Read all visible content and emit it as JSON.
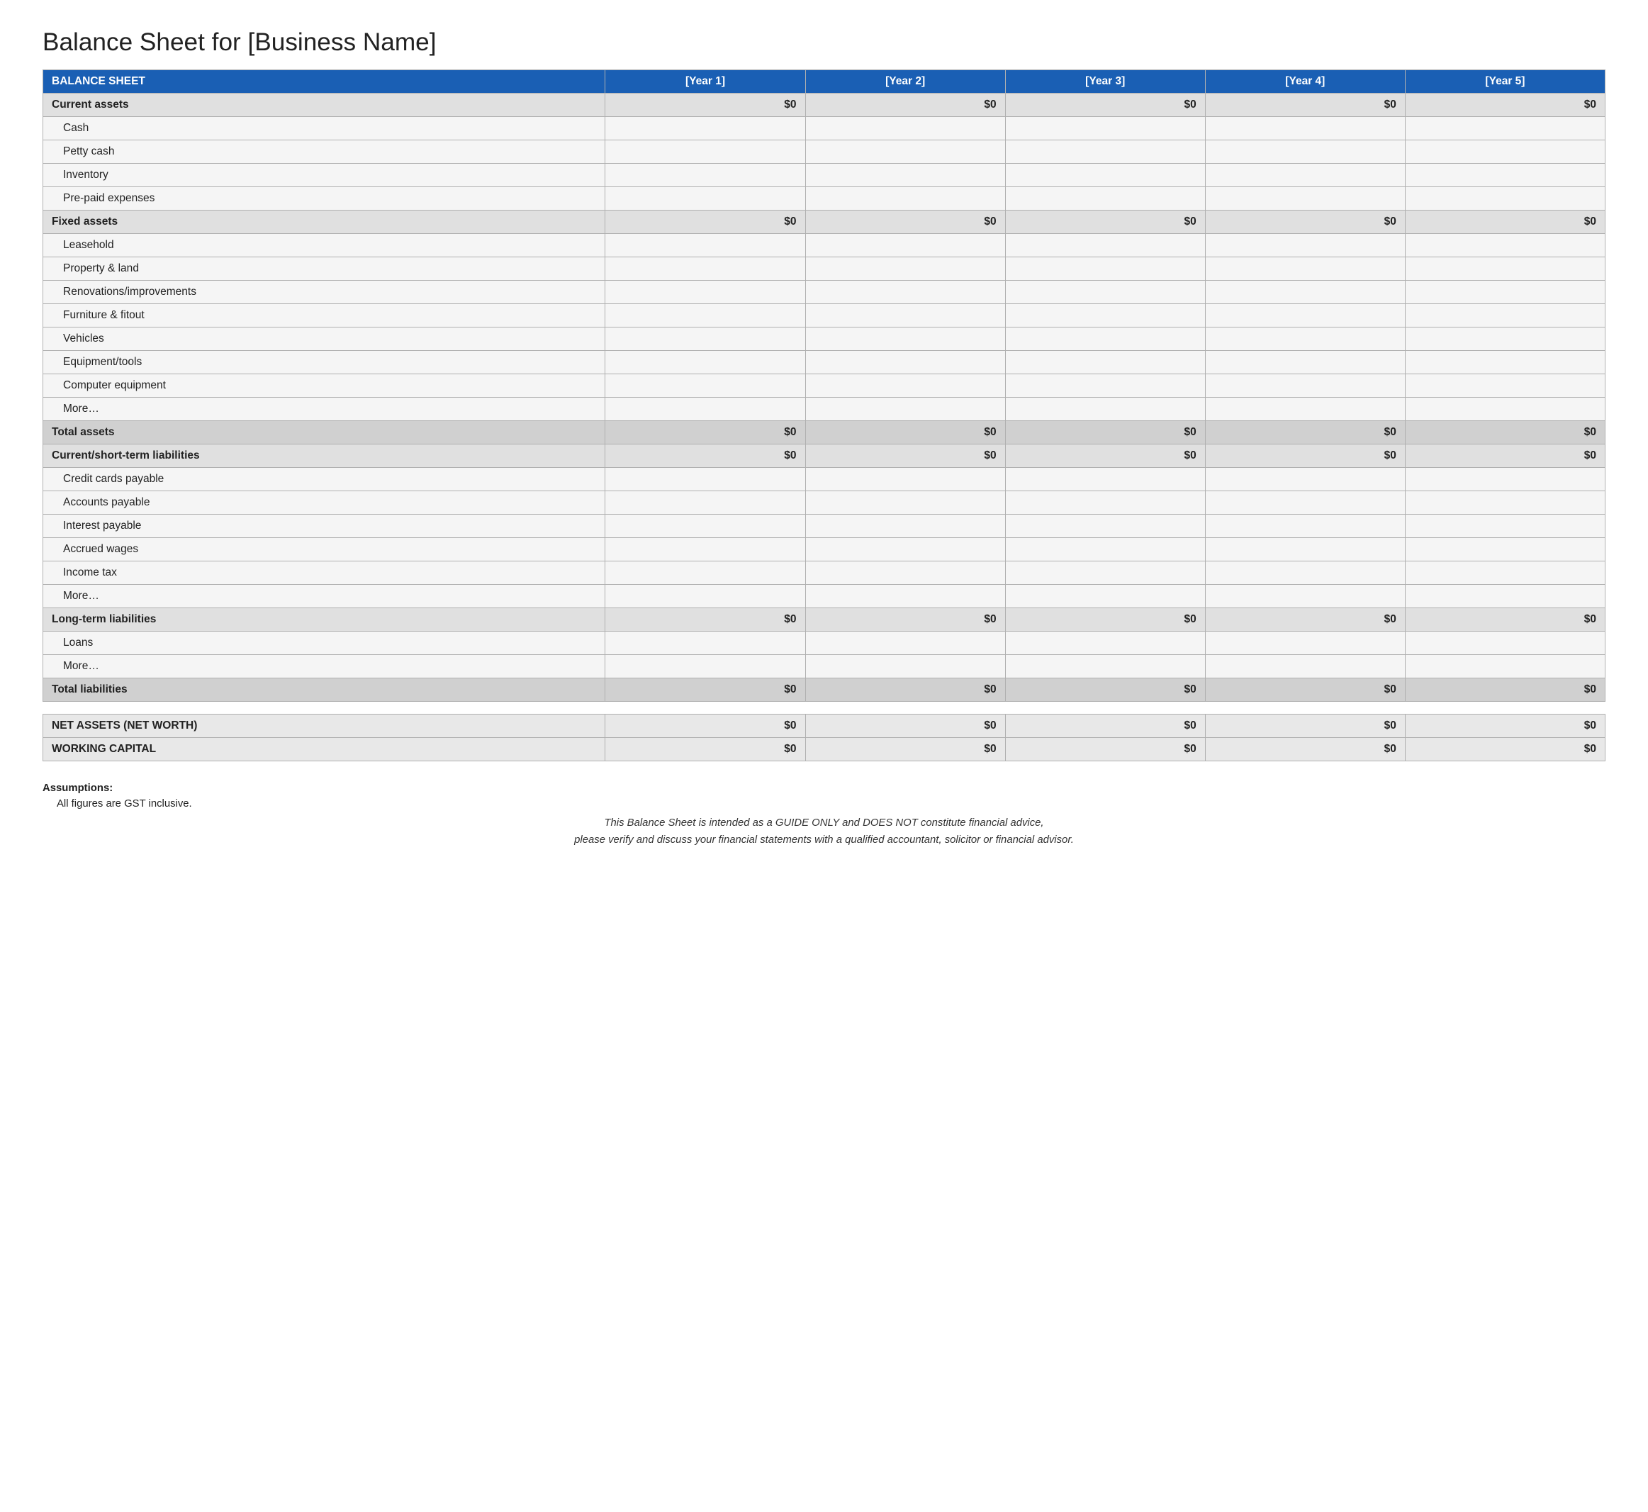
{
  "title": "Balance Sheet for [Business Name]",
  "header": {
    "col1": "BALANCE SHEET",
    "col2": "[Year 1]",
    "col3": "[Year 2]",
    "col4": "[Year 3]",
    "col5": "[Year 4]",
    "col6": "[Year 5]"
  },
  "sections": [
    {
      "type": "section-header",
      "label": "Current assets",
      "values": [
        "$0",
        "$0",
        "$0",
        "$0",
        "$0"
      ]
    },
    {
      "type": "sub-row",
      "label": "Cash",
      "values": [
        "",
        "",
        "",
        "",
        ""
      ]
    },
    {
      "type": "sub-row",
      "label": "Petty cash",
      "values": [
        "",
        "",
        "",
        "",
        ""
      ]
    },
    {
      "type": "sub-row",
      "label": "Inventory",
      "values": [
        "",
        "",
        "",
        "",
        ""
      ]
    },
    {
      "type": "sub-row",
      "label": "Pre-paid expenses",
      "values": [
        "",
        "",
        "",
        "",
        ""
      ]
    },
    {
      "type": "section-header",
      "label": "Fixed assets",
      "values": [
        "$0",
        "$0",
        "$0",
        "$0",
        "$0"
      ]
    },
    {
      "type": "sub-row",
      "label": "Leasehold",
      "values": [
        "",
        "",
        "",
        "",
        ""
      ]
    },
    {
      "type": "sub-row",
      "label": "Property & land",
      "values": [
        "",
        "",
        "",
        "",
        ""
      ]
    },
    {
      "type": "sub-row",
      "label": "Renovations/improvements",
      "values": [
        "",
        "",
        "",
        "",
        ""
      ]
    },
    {
      "type": "sub-row",
      "label": "Furniture & fitout",
      "values": [
        "",
        "",
        "",
        "",
        ""
      ]
    },
    {
      "type": "sub-row",
      "label": "Vehicles",
      "values": [
        "",
        "",
        "",
        "",
        ""
      ]
    },
    {
      "type": "sub-row",
      "label": "Equipment/tools",
      "values": [
        "",
        "",
        "",
        "",
        ""
      ]
    },
    {
      "type": "sub-row",
      "label": "Computer equipment",
      "values": [
        "",
        "",
        "",
        "",
        ""
      ]
    },
    {
      "type": "sub-row",
      "label": "More…",
      "values": [
        "",
        "",
        "",
        "",
        ""
      ]
    },
    {
      "type": "total-row",
      "label": "Total assets",
      "values": [
        "$0",
        "$0",
        "$0",
        "$0",
        "$0"
      ]
    },
    {
      "type": "section-header",
      "label": "Current/short-term liabilities",
      "values": [
        "$0",
        "$0",
        "$0",
        "$0",
        "$0"
      ]
    },
    {
      "type": "sub-row",
      "label": "Credit cards payable",
      "values": [
        "",
        "",
        "",
        "",
        ""
      ]
    },
    {
      "type": "sub-row",
      "label": "Accounts payable",
      "values": [
        "",
        "",
        "",
        "",
        ""
      ]
    },
    {
      "type": "sub-row",
      "label": "Interest payable",
      "values": [
        "",
        "",
        "",
        "",
        ""
      ]
    },
    {
      "type": "sub-row",
      "label": "Accrued wages",
      "values": [
        "",
        "",
        "",
        "",
        ""
      ]
    },
    {
      "type": "sub-row",
      "label": "Income tax",
      "values": [
        "",
        "",
        "",
        "",
        ""
      ]
    },
    {
      "type": "sub-row",
      "label": "More…",
      "values": [
        "",
        "",
        "",
        "",
        ""
      ]
    },
    {
      "type": "section-header",
      "label": "Long-term liabilities",
      "values": [
        "$0",
        "$0",
        "$0",
        "$0",
        "$0"
      ]
    },
    {
      "type": "sub-row",
      "label": "Loans",
      "values": [
        "",
        "",
        "",
        "",
        ""
      ]
    },
    {
      "type": "sub-row",
      "label": "More…",
      "values": [
        "",
        "",
        "",
        "",
        ""
      ]
    },
    {
      "type": "total-row",
      "label": "Total liabilities",
      "values": [
        "$0",
        "$0",
        "$0",
        "$0",
        "$0"
      ]
    },
    {
      "type": "empty-row"
    },
    {
      "type": "summary-row",
      "label": "NET ASSETS (NET WORTH)",
      "values": [
        "$0",
        "$0",
        "$0",
        "$0",
        "$0"
      ]
    },
    {
      "type": "summary-row",
      "label": "WORKING CAPITAL",
      "values": [
        "$0",
        "$0",
        "$0",
        "$0",
        "$0"
      ]
    }
  ],
  "assumptions": {
    "title": "Assumptions:",
    "gst_note": "All figures are GST inclusive.",
    "disclaimer": "This Balance Sheet is intended as a GUIDE ONLY and DOES NOT constitute financial advice,\nplease verify and discuss your financial statements with a qualified accountant, solicitor or financial advisor."
  }
}
